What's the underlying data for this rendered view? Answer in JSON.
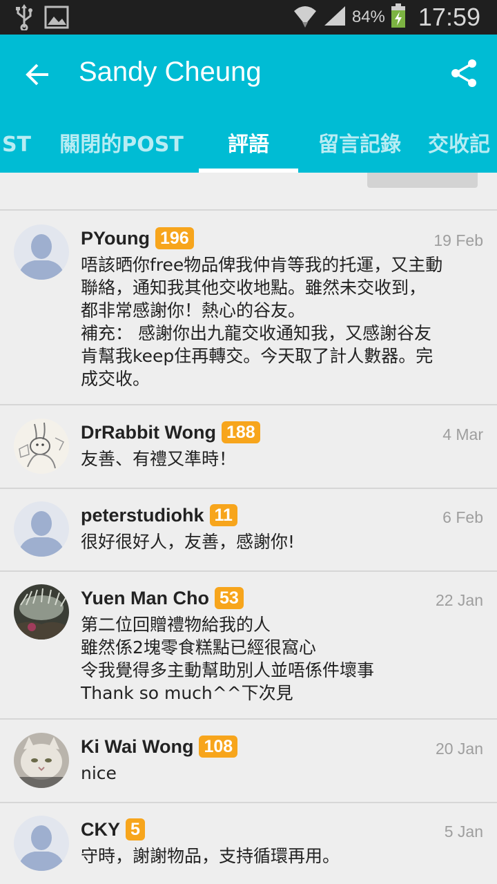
{
  "status_bar": {
    "battery_pct": "84%",
    "time": "17:59",
    "icons": [
      "usb-icon",
      "image-icon",
      "wifi-icon",
      "signal-icon",
      "battery-charging-icon"
    ]
  },
  "header": {
    "title": "Sandy Cheung",
    "back_icon": "arrow-left-icon",
    "share_icon": "share-icon"
  },
  "tabs": [
    {
      "label": "ST",
      "active": false
    },
    {
      "label": "關閉的POST",
      "active": false
    },
    {
      "label": "評語",
      "active": true
    },
    {
      "label": "留言記錄",
      "active": false
    },
    {
      "label": "交收記",
      "active": false
    }
  ],
  "comments": [
    {
      "name": "PYoung",
      "score": "196",
      "date": "19 Feb",
      "avatar": "default",
      "text": "唔該晒你free物品俾我仲肯等我的托運，又主動\n聯絡，通知我其他交收地點。雖然未交收到，\n都非常感謝你！熱心的谷友。\n補充： 感謝你出九龍交收通知我，又感謝谷友\n肯幫我keep住再轉交。今天取了計人數器。完\n成交收。"
    },
    {
      "name": "DrRabbit Wong",
      "score": "188",
      "date": "4 Mar",
      "avatar": "rabbit-sketch",
      "text": "友善、有禮又準時！"
    },
    {
      "name": "peterstudiohk",
      "score": "11",
      "date": "6 Feb",
      "avatar": "default",
      "text": "很好很好人，友善，感謝你!"
    },
    {
      "name": "Yuen Man Cho",
      "score": "53",
      "date": "22 Jan",
      "avatar": "plant-photo",
      "text": "第二位回贈禮物給我的人\n雖然係2塊零食糕點已經很窩心\n令我覺得多主動幫助別人並唔係件壞事\nThank so much^^下次見"
    },
    {
      "name": "Ki Wai Wong",
      "score": "108",
      "date": "20 Jan",
      "avatar": "cat-photo",
      "text": "nice"
    },
    {
      "name": "CKY",
      "score": "5",
      "date": "5 Jan",
      "avatar": "default",
      "text": "守時，謝謝物品，支持循環再用。"
    }
  ]
}
